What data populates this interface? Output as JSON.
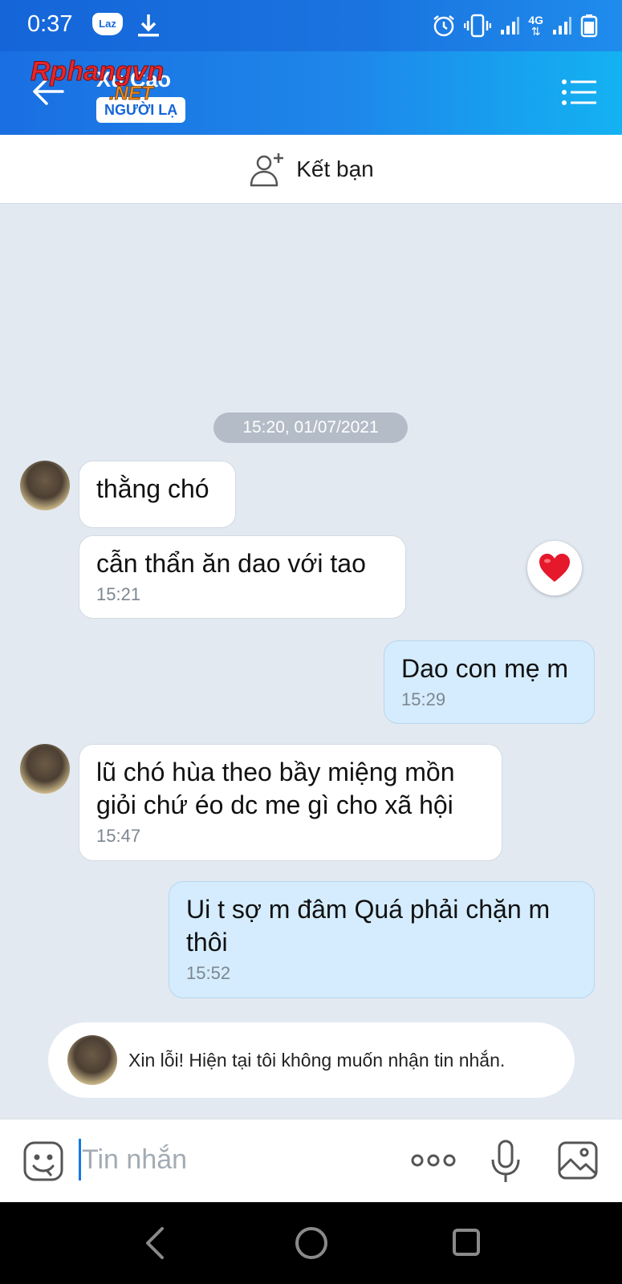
{
  "status_bar": {
    "time": "0:37",
    "laz_label": "Laz",
    "network_label": "4G"
  },
  "header": {
    "contact_name": "Xu Cao",
    "badge": "NGƯỜI LẠ",
    "watermark_line1": "Rphangvn",
    "watermark_line2": ".NET"
  },
  "add_friend": {
    "label": "Kết bạn"
  },
  "chat": {
    "date_separator": "15:20, 01/07/2021",
    "messages": [
      {
        "direction": "in",
        "text": "thằng chó",
        "time": ""
      },
      {
        "direction": "in",
        "text": "cẫn thẩn ăn dao với tao",
        "time": "15:21",
        "reaction": "heart"
      },
      {
        "direction": "out",
        "text": "Dao con mẹ m",
        "time": "15:29"
      },
      {
        "direction": "in",
        "text": "lũ chó hùa theo bầy miệng mồn giỏi chứ éo dc me gì cho xã hội",
        "time": "15:47"
      },
      {
        "direction": "out",
        "text": "Ui t sợ m đâm Quá phải chặn m thôi",
        "time": "15:52"
      }
    ],
    "notice": "Xin lỗi! Hiện tại tôi không muốn nhận tin nhắn."
  },
  "input_bar": {
    "placeholder": "Tin nhắn"
  },
  "colors": {
    "header_blue": "#1a74e0",
    "out_bubble": "#d4ecfd",
    "chat_bg": "#e2e9f1",
    "heart": "#e5182c"
  }
}
